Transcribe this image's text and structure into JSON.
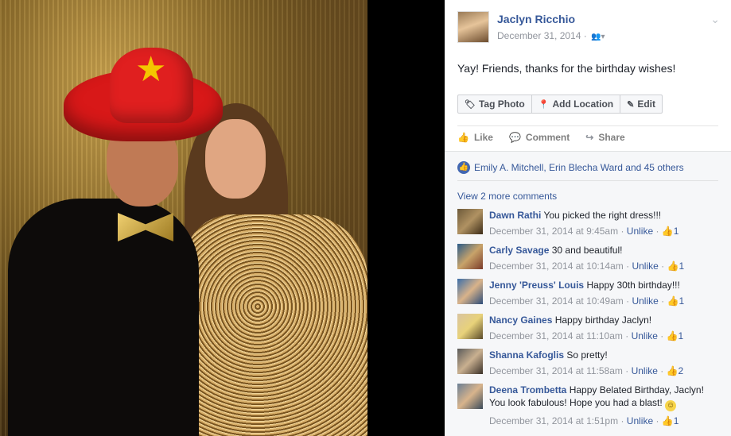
{
  "post": {
    "author": "Jaclyn Ricchio",
    "date": "December 31, 2014",
    "audience_separator": "·",
    "audience_icon": "friends-icon",
    "status_text": "Yay! Friends, thanks for the birthday wishes!"
  },
  "photo_actions": {
    "tag_photo": "Tag Photo",
    "add_location": "Add Location",
    "edit": "Edit"
  },
  "ufi_actions": {
    "like": "Like",
    "comment": "Comment",
    "share": "Share"
  },
  "likers": "Emily A. Mitchell, Erin Blecha Ward and 45 others",
  "view_more": "View 2 more comments",
  "comments": [
    {
      "name": "Dawn Rathi",
      "text": "You picked the right dress!!!",
      "time": "December 31, 2014 at 9:45am",
      "unlike": "Unlike",
      "likes": "1"
    },
    {
      "name": "Carly Savage",
      "text": "30 and beautiful!",
      "time": "December 31, 2014 at 10:14am",
      "unlike": "Unlike",
      "likes": "1"
    },
    {
      "name": "Jenny 'Preuss' Louis",
      "text": "Happy 30th birthday!!!",
      "time": "December 31, 2014 at 10:49am",
      "unlike": "Unlike",
      "likes": "1"
    },
    {
      "name": "Nancy Gaines",
      "text": "Happy birthday Jaclyn!",
      "time": "December 31, 2014 at 11:10am",
      "unlike": "Unlike",
      "likes": "1"
    },
    {
      "name": "Shanna Kafoglis",
      "text": "So pretty!",
      "time": "December 31, 2014 at 11:58am",
      "unlike": "Unlike",
      "likes": "2"
    },
    {
      "name": "Deena Trombetta",
      "text": "Happy Belated Birthday, Jaclyn! You look fabulous! Hope you had a blast!",
      "time": "December 31, 2014 at 1:51pm",
      "unlike": "Unlike",
      "likes": "1"
    }
  ],
  "colors": {
    "link": "#365899",
    "meta": "#90949c",
    "ufi_bg": "#f6f7f9",
    "like_blue": "#4267b2"
  }
}
